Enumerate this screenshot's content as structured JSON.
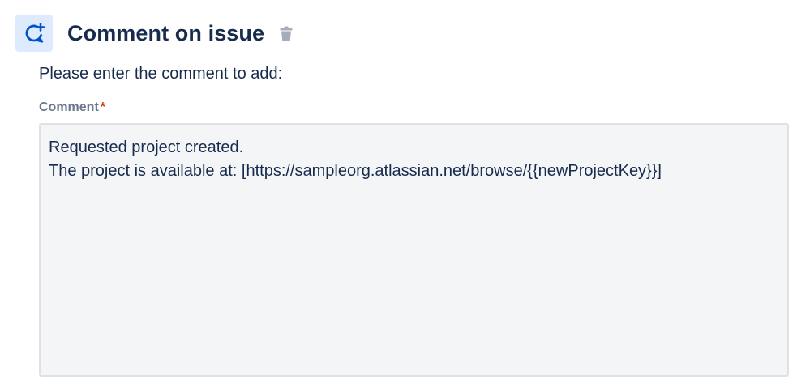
{
  "header": {
    "action_icon": "comment-add-icon",
    "title": "Comment on issue",
    "delete_icon": "trash-icon"
  },
  "form": {
    "instructions": "Please enter the comment to add:",
    "comment_label": "Comment",
    "required_marker": "*",
    "comment_value": "Requested project created.\nThe project is available at: [https://sampleorg.atlassian.net/browse/{{newProjectKey}}]"
  },
  "colors": {
    "icon_background": "#deebff",
    "icon_accent": "#0052cc",
    "text_primary": "#172b4d",
    "label_text": "#6b778c",
    "required": "#de350b",
    "field_background": "#f4f5f7",
    "field_border": "#dfe1e6",
    "trash_icon": "#a5adba"
  }
}
